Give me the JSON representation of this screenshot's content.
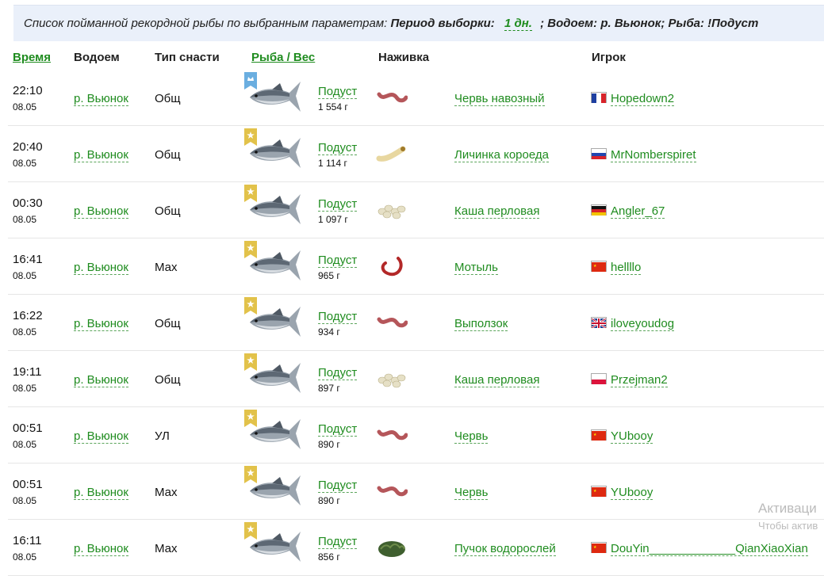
{
  "banner": {
    "prefix": "Список пойманной рекордной рыбы по выбранным параметрам:",
    "period_label": "Период выборки:",
    "period_value": "1 дн.",
    "suffix": "; Водоем: р. Вьюнок; Рыба: !Подуст"
  },
  "headers": {
    "time": "Время",
    "lake": "Водоем",
    "gear": "Тип снасти",
    "fish": "Рыба / Вес",
    "bait": "Наживка",
    "player": "Игрок"
  },
  "rows": [
    {
      "time": "22:10",
      "date": "08.05",
      "lake": "р. Вьюнок",
      "gear": "Общ",
      "badge": "crown",
      "fish": "Подуст",
      "weight": "1 554 г",
      "bait": "Червь навозный",
      "bait_icon": "worm-icon",
      "flag": "france",
      "player": "Hopedown2"
    },
    {
      "time": "20:40",
      "date": "08.05",
      "lake": "р. Вьюнок",
      "gear": "Общ",
      "badge": "star",
      "fish": "Подуст",
      "weight": "1 114 г",
      "bait": "Личинка короеда",
      "bait_icon": "larva-icon",
      "flag": "russia",
      "player": "MrNomberspiret"
    },
    {
      "time": "00:30",
      "date": "08.05",
      "lake": "р. Вьюнок",
      "gear": "Общ",
      "badge": "star",
      "fish": "Подуст",
      "weight": "1 097 г",
      "bait": "Каша перловая",
      "bait_icon": "porridge-icon",
      "flag": "germany",
      "player": "Angler_67"
    },
    {
      "time": "16:41",
      "date": "08.05",
      "lake": "р. Вьюнок",
      "gear": "Мах",
      "badge": "star",
      "fish": "Подуст",
      "weight": "965 г",
      "bait": "Мотыль",
      "bait_icon": "bloodworm-icon",
      "flag": "china",
      "player": "hellllo"
    },
    {
      "time": "16:22",
      "date": "08.05",
      "lake": "р. Вьюнок",
      "gear": "Общ",
      "badge": "star",
      "fish": "Подуст",
      "weight": "934 г",
      "bait": "Выползок",
      "bait_icon": "worm-icon",
      "flag": "uk",
      "player": "iloveyoudog"
    },
    {
      "time": "19:11",
      "date": "08.05",
      "lake": "р. Вьюнок",
      "gear": "Общ",
      "badge": "star",
      "fish": "Подуст",
      "weight": "897 г",
      "bait": "Каша перловая",
      "bait_icon": "porridge-icon",
      "flag": "poland",
      "player": "Przejman2"
    },
    {
      "time": "00:51",
      "date": "08.05",
      "lake": "р. Вьюнок",
      "gear": "УЛ",
      "badge": "star",
      "fish": "Подуст",
      "weight": "890 г",
      "bait": "Червь",
      "bait_icon": "worm-icon",
      "flag": "china",
      "player": "YUbooy"
    },
    {
      "time": "00:51",
      "date": "08.05",
      "lake": "р. Вьюнок",
      "gear": "Мах",
      "badge": "star",
      "fish": "Подуст",
      "weight": "890 г",
      "bait": "Червь",
      "bait_icon": "worm-icon",
      "flag": "china",
      "player": "YUbooy"
    },
    {
      "time": "16:11",
      "date": "08.05",
      "lake": "р. Вьюнок",
      "gear": "Мах",
      "badge": "star",
      "fish": "Подуст",
      "weight": "856 г",
      "bait": "Пучок водорослей",
      "bait_icon": "algae-icon",
      "flag": "china",
      "player": "DouYin_____________QianXiaoXian"
    }
  ],
  "watermark": {
    "line1": "Активаци",
    "line2": "Чтобы актив"
  },
  "colors": {
    "link": "#1f8c1f",
    "banner_bg": "#eaf0fa",
    "gold_badge": "#e2c24a",
    "blue_badge": "#6aaee0"
  }
}
